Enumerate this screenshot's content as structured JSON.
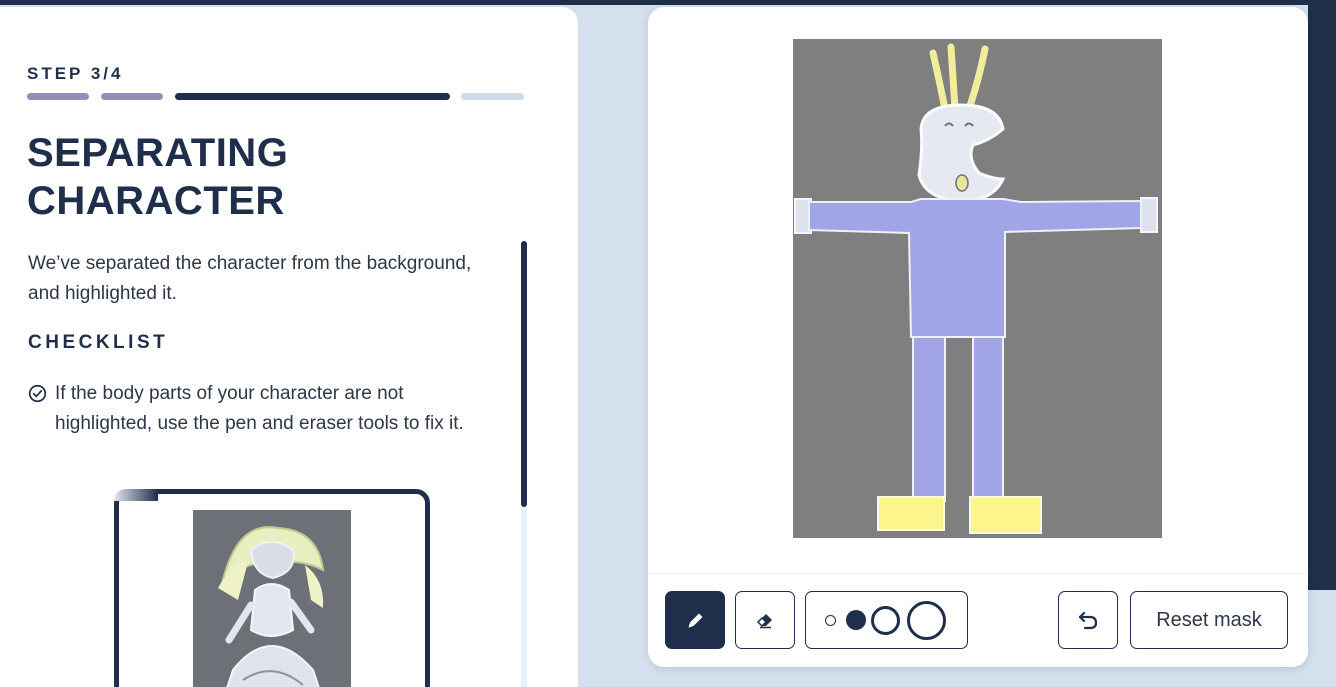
{
  "step": {
    "label": "STEP 3/4",
    "current": 3,
    "total": 4
  },
  "title": {
    "line1": "SEPARATING",
    "line2": "CHARACTER"
  },
  "intro": "We’ve separated the character from the background, and highlighted it.",
  "checklist": {
    "heading": "CHECKLIST",
    "items": [
      {
        "text": "If the body parts of your character are not highlighted, use the pen and eraser tools to fix it.",
        "icon": "check-circle-icon"
      }
    ]
  },
  "toolbar": {
    "pen": {
      "icon": "pencil-icon",
      "active": true
    },
    "eraser": {
      "icon": "eraser-icon"
    },
    "brush_sizes": {
      "icon": "brush-size-icon",
      "selected": "medium",
      "options": [
        "small",
        "medium",
        "large",
        "extra-large"
      ]
    },
    "undo": {
      "icon": "undo-icon"
    },
    "reset_label": "Reset mask"
  },
  "colors": {
    "navy": "#1f2e4a",
    "mask_purple": "#a1a4e6",
    "mask_yellow": "#fcf58b",
    "canvas_gray": "#7f7f7f",
    "page_bg": "#d4e0ee"
  }
}
